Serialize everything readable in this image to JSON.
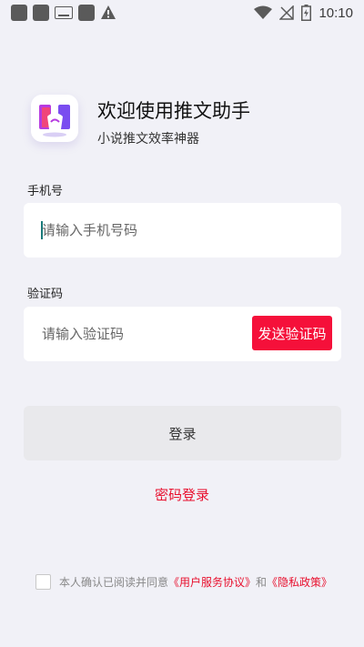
{
  "status_bar": {
    "time": "10:10",
    "icons": [
      "notification-square-icon",
      "notification-square-icon",
      "keyboard-icon",
      "notification-square-icon",
      "warning-icon",
      "wifi-icon",
      "no-signal-icon",
      "battery-charging-icon"
    ]
  },
  "header": {
    "logo_icon": "book-hand-logo-icon",
    "title": "欢迎使用推文助手",
    "subtitle": "小说推文效率神器"
  },
  "phone": {
    "label": "手机号",
    "placeholder": "请输入手机号码",
    "value": ""
  },
  "code": {
    "label": "验证码",
    "placeholder": "请输入验证码",
    "value": "",
    "send_label": "发送验证码"
  },
  "login_label": "登录",
  "password_login_label": "密码登录",
  "agreement": {
    "prefix": "本人确认已阅读并同意",
    "user_agreement": "《用户服务协议》",
    "joiner": "和",
    "privacy_policy": "《隐私政策》",
    "checked": false
  },
  "colors": {
    "accent": "#f5103a",
    "link": "#e8102e",
    "background": "#f1f1f7",
    "button_disabled": "#e9e9ec"
  }
}
